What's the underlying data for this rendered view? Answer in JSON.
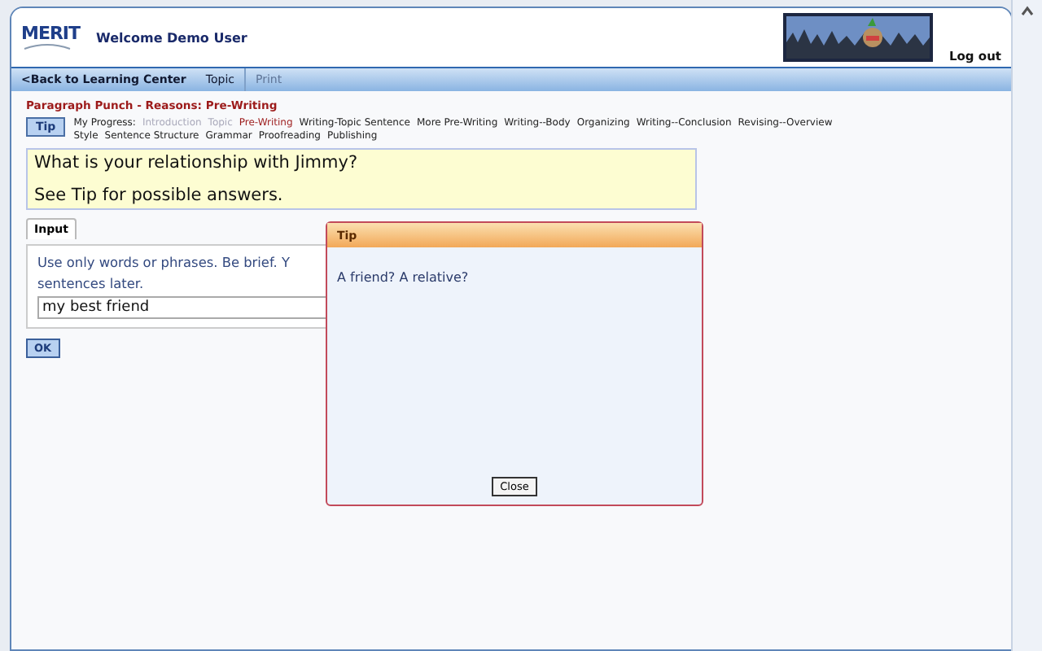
{
  "header": {
    "logo": "MERIT",
    "welcome": "Welcome Demo User",
    "logout": "Log out"
  },
  "nav": [
    {
      "label": "<Back to Learning Center",
      "disabled": false
    },
    {
      "label": "Topic",
      "disabled": false
    },
    {
      "label": "Print",
      "disabled": true
    }
  ],
  "page_title": "Paragraph Punch - Reasons: Pre-Writing",
  "tip_button": "Tip",
  "progress": {
    "label": "My Progress:",
    "steps": [
      {
        "label": "Introduction",
        "completed": true,
        "selected": false
      },
      {
        "label": "Topic",
        "completed": true,
        "selected": false
      },
      {
        "label": "Pre-Writing",
        "completed": false,
        "selected": true
      },
      {
        "label": "Writing-Topic Sentence",
        "completed": false,
        "selected": false
      },
      {
        "label": "More Pre-Writing",
        "completed": false,
        "selected": false
      },
      {
        "label": "Writing--Body",
        "completed": false,
        "selected": false
      },
      {
        "label": "Organizing",
        "completed": false,
        "selected": false
      },
      {
        "label": "Writing--Conclusion",
        "completed": false,
        "selected": false
      },
      {
        "label": "Revising--Overview",
        "completed": false,
        "selected": false
      },
      {
        "label": "Style",
        "completed": false,
        "selected": false
      },
      {
        "label": "Sentence Structure",
        "completed": false,
        "selected": false
      },
      {
        "label": "Grammar",
        "completed": false,
        "selected": false
      },
      {
        "label": "Proofreading",
        "completed": false,
        "selected": false
      },
      {
        "label": "Publishing",
        "completed": false,
        "selected": false
      }
    ]
  },
  "question": [
    "What is your relationship with Jimmy?",
    "See Tip for possible answers."
  ],
  "input_panel": {
    "tab": "Input",
    "instructions": [
      "Use only words or phrases. Be brief. Y",
      "sentences later."
    ],
    "value": "my best friend"
  },
  "ok_button": "OK",
  "tip_dialog": {
    "title": "Tip",
    "text": "A friend? A relative?",
    "close": "Close"
  }
}
